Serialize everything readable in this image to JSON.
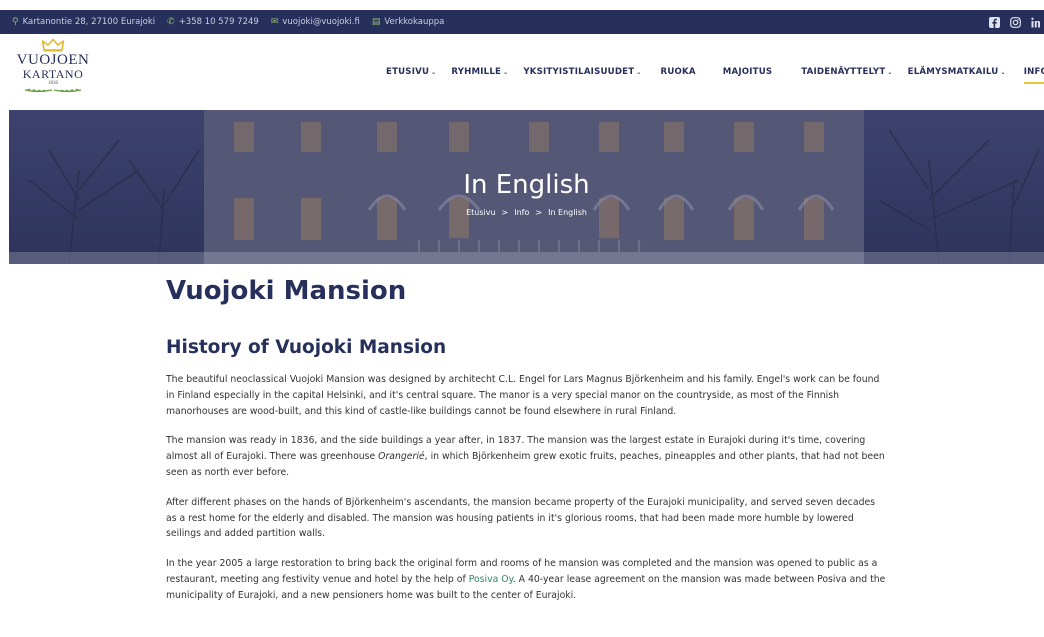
{
  "topbar": {
    "address": "Kartanontie 28, 27100 Eurajoki",
    "phone": "+358 10 579 7249",
    "email": "vuojoki@vuojoki.fi",
    "shop": "Verkkokauppa",
    "social": [
      "facebook-icon",
      "instagram-icon",
      "linkedin-icon"
    ]
  },
  "logo": {
    "line1": "VUOJOEN",
    "line2": "KARTANO",
    "year": "1836"
  },
  "nav": {
    "items": [
      {
        "label": "ETUSIVU",
        "dropdown": true
      },
      {
        "label": "RYHMILLE",
        "dropdown": true
      },
      {
        "label": "YKSITYISTILAISUUDET",
        "dropdown": true
      },
      {
        "label": "RUOKA",
        "dropdown": false
      },
      {
        "label": "MAJOITUS",
        "dropdown": false
      },
      {
        "label": "TAIDENÄYTTELYT",
        "dropdown": true
      },
      {
        "label": "ELÄMYSMATKAILU",
        "dropdown": true
      },
      {
        "label": "INFO",
        "dropdown": true
      }
    ],
    "active": "INFO",
    "chevron": "⌄"
  },
  "hero": {
    "title": "In English",
    "breadcrumb": [
      "Etusivu",
      "Info",
      "In English"
    ],
    "separator": ">"
  },
  "content": {
    "heading": "Vuojoki Mansion",
    "subheading": "History of Vuojoki Mansion",
    "p1": "The beautiful neoclassical Vuojoki Mansion was designed by architecht C.L. Engel for Lars Magnus Björkenheim and his family. Engel's work can be found in Finland especially in the capital Helsinki, and it's central square. The manor is a very special manor on the countryside, as most of the Finnish manorhouses are wood-built, and this kind of castle-like buildings cannot be found elsewhere in rural Finland.",
    "p2_before": "The mansion was ready in 1836, and the side buildings a year after, in 1837. The mansion was the largest estate in Eurajoki during it's time, covering almost all of Eurajoki. There was greenhouse ",
    "p2_em": "Orangerié",
    "p2_after": ", in which Björkenheim grew exotic fruits, peaches, pineapples and other plants, that had not been seen as north ever before.",
    "p3": "After different phases on the hands of Björkenheim's ascendants, the mansion became property of the Eurajoki municipality, and served seven decades as a rest home for the elderly and disabled. The mansion was housing patients in it's glorious rooms, that had been made more humble by lowered seilings and added partition walls.",
    "p4_before": "In the year 2005 a large restoration to bring back the original form and rooms of he mansion was completed and the mansion was opened to public as a restaurant, meeting ang festivity venue and hotel by the help of ",
    "p4_link": "Posiva Oy",
    "p4_after": ". A 40-year lease agreement on the mansion was made between Posiva and the municipality of Eurajoki, and a new pensioners home was built to the center of Eurajoki."
  },
  "colors": {
    "navy": "#27305a",
    "accent": "#e9c33a",
    "link": "#2f8a5d"
  }
}
